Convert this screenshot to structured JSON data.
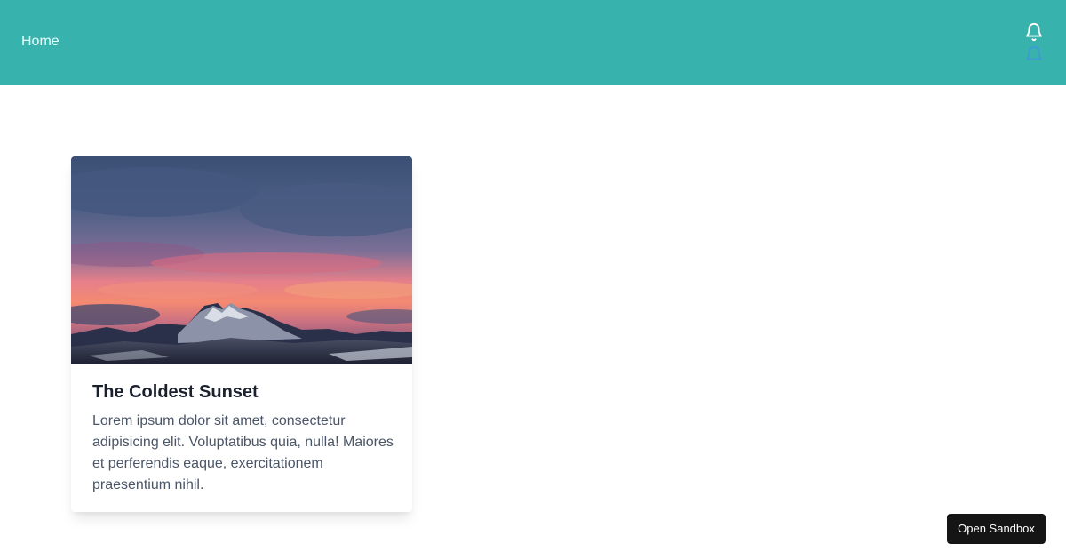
{
  "header": {
    "nav_home": "Home",
    "icons": [
      "bell-icon",
      "bell-icon"
    ],
    "background_color": "#38b2ac"
  },
  "card": {
    "image_icon": "mountain-sunset-image",
    "title": "The Coldest Sunset",
    "text": "Lorem ipsum dolor sit amet, consectetur adipisicing elit. Voluptatibus quia, nulla! Maiores et perferendis eaque, exercitationem praesentium nihil."
  },
  "footer": {
    "sandbox_label": "Open Sandbox"
  }
}
